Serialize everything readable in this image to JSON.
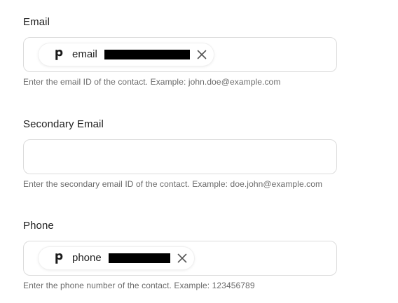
{
  "fields": {
    "email": {
      "label": "Email",
      "chip_text": "email",
      "helper": "Enter the email ID of the contact. Example: john.doe@example.com"
    },
    "secondary_email": {
      "label": "Secondary Email",
      "value": "",
      "helper": "Enter the secondary email ID of the contact. Example: doe.john@example.com"
    },
    "phone": {
      "label": "Phone",
      "chip_text": "phone",
      "helper": "Enter the phone number of the contact. Example: 123456789"
    }
  },
  "icons": {
    "chip_logo": "pipedrive-p-icon",
    "chip_remove": "close-icon"
  },
  "colors": {
    "label_text": "#222222",
    "helper_text": "#6b6b6b",
    "field_border": "#dcdcdc",
    "redaction": "#000000"
  }
}
